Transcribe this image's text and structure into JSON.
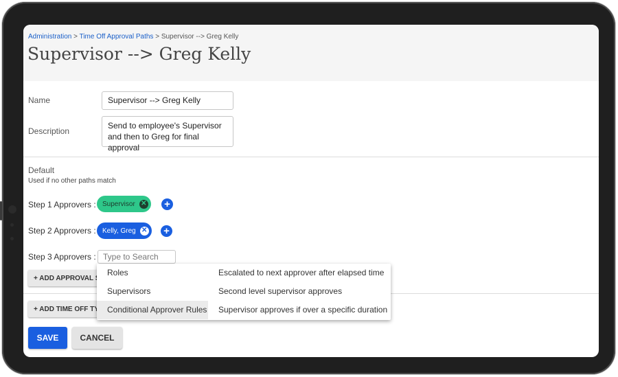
{
  "breadcrumb": {
    "items": [
      {
        "label": "Administration"
      },
      {
        "label": "Time Off Approval Paths"
      },
      {
        "label": "Supervisor --> Greg Kelly"
      }
    ],
    "separator": ">"
  },
  "page_title": "Supervisor --> Greg Kelly",
  "form": {
    "name_label": "Name",
    "name_value": "Supervisor --> Greg Kelly",
    "description_label": "Description",
    "description_value": "Send to employee's Supervisor\nand then to Greg for final approval"
  },
  "default_section": {
    "title": "Default",
    "subtitle": "Used if no other paths match"
  },
  "steps": [
    {
      "label": "Step 1 Approvers :",
      "chip": "Supervisor",
      "chip_color": "#2ec78a"
    },
    {
      "label": "Step 2 Approvers :",
      "chip": "Kelly, Greg",
      "chip_color": "#1a5fe0"
    },
    {
      "label": "Step 3 Approvers :",
      "search_placeholder": "Type to Search"
    }
  ],
  "buttons": {
    "add_approval_step": "+ ADD APPROVAL STEP",
    "add_time_off_type": "+ ADD TIME OFF TYPE",
    "save": "SAVE",
    "cancel": "CANCEL"
  },
  "dropdown": {
    "options": [
      {
        "name": "Roles",
        "description": "Escalated to next approver after elapsed time"
      },
      {
        "name": "Supervisors",
        "description": "Second level supervisor approves"
      },
      {
        "name": "Conditional Approver Rules",
        "description": "Supervisor approves if over a specific duration"
      }
    ],
    "highlighted_index": 2
  },
  "colors": {
    "accent": "#1a5fe0",
    "success": "#2ec78a",
    "link": "#1a5fc8"
  },
  "icons": {
    "remove": "close-circle-icon",
    "add": "plus-circle-icon"
  }
}
